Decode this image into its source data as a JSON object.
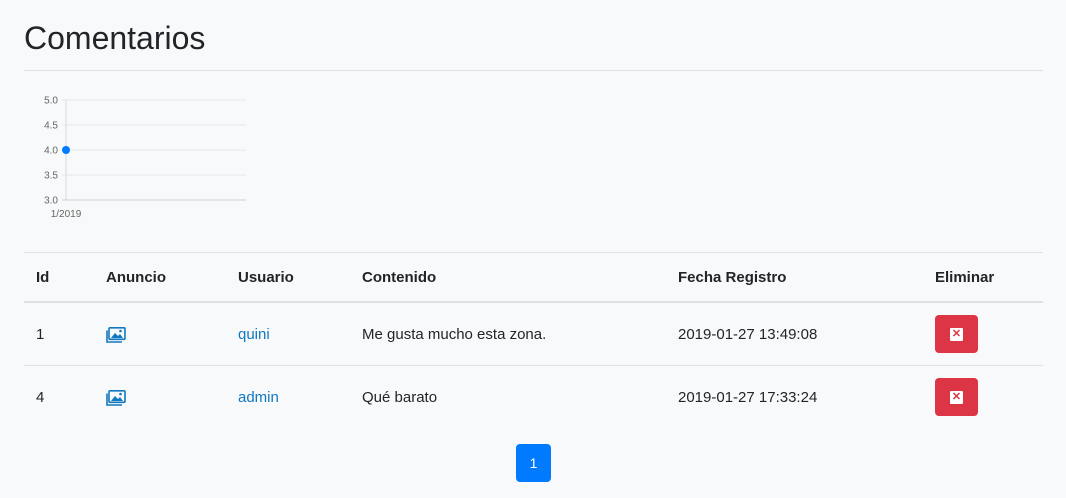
{
  "page": {
    "title": "Comentarios"
  },
  "chart_data": {
    "type": "line",
    "x": [
      "1/2019"
    ],
    "series": [
      {
        "values": [
          4.0
        ],
        "color": "#007bff"
      }
    ],
    "yticks": [
      "5.0",
      "4.5",
      "4.0",
      "3.5",
      "3.0"
    ],
    "ylim": [
      3.0,
      5.0
    ],
    "xlabel": "",
    "ylabel": "",
    "grid": true
  },
  "table": {
    "headers": {
      "id": "Id",
      "anuncio": "Anuncio",
      "usuario": "Usuario",
      "contenido": "Contenido",
      "fecha": "Fecha Registro",
      "eliminar": "Eliminar"
    },
    "rows": [
      {
        "id": "1",
        "anuncio_icon": "image-icon",
        "usuario": "quini",
        "contenido": "Me gusta mucho esta zona.",
        "fecha": "2019-01-27 13:49:08",
        "eliminar_icon": "close-icon"
      },
      {
        "id": "4",
        "anuncio_icon": "image-icon",
        "usuario": "admin",
        "contenido": "Qué barato",
        "fecha": "2019-01-27 17:33:24",
        "eliminar_icon": "close-icon"
      }
    ]
  },
  "pagination": {
    "current": "1"
  },
  "colors": {
    "link": "#1178c0",
    "danger": "#dc3545",
    "primary": "#007bff"
  }
}
